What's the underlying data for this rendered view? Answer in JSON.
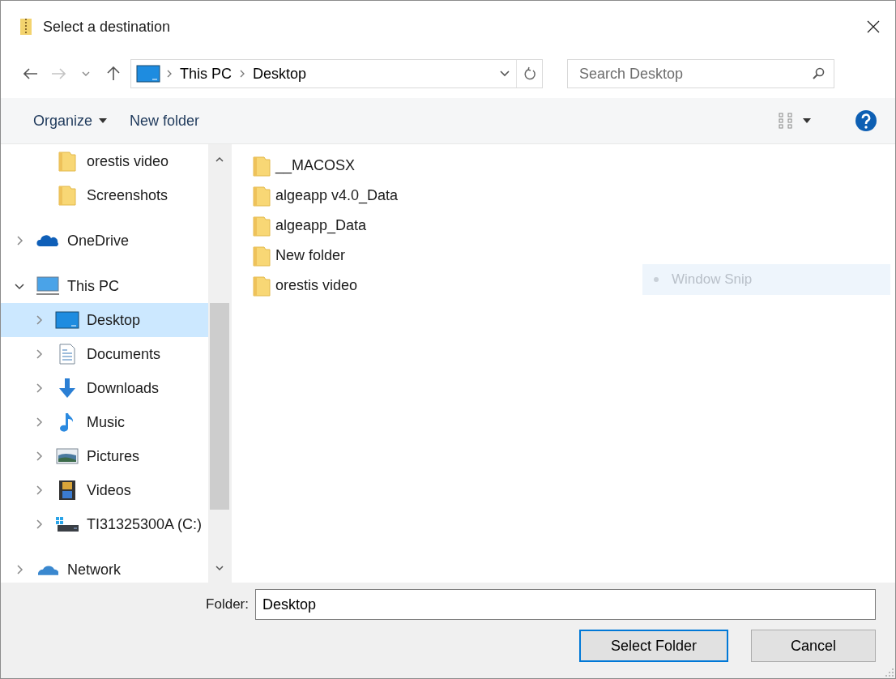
{
  "window": {
    "title": "Select a destination"
  },
  "address": {
    "crumbs": [
      "This PC",
      "Desktop"
    ]
  },
  "search": {
    "placeholder": "Search Desktop"
  },
  "toolbar": {
    "organize": "Organize",
    "new_folder": "New folder"
  },
  "sidebar": {
    "quick_access_children": [
      {
        "label": "orestis video",
        "kind": "folder"
      },
      {
        "label": "Screenshots",
        "kind": "folder"
      }
    ],
    "items": [
      {
        "label": "OneDrive",
        "kind": "onedrive",
        "expanded": false,
        "selected": false
      },
      {
        "label": "This PC",
        "kind": "pc",
        "expanded": true,
        "selected": false,
        "children": [
          {
            "label": "Desktop",
            "kind": "desktop",
            "expanded": false,
            "selected": true
          },
          {
            "label": "Documents",
            "kind": "documents",
            "expanded": false,
            "selected": false
          },
          {
            "label": "Downloads",
            "kind": "downloads",
            "expanded": false,
            "selected": false
          },
          {
            "label": "Music",
            "kind": "music",
            "expanded": false,
            "selected": false
          },
          {
            "label": "Pictures",
            "kind": "pictures",
            "expanded": false,
            "selected": false
          },
          {
            "label": "Videos",
            "kind": "videos",
            "expanded": false,
            "selected": false
          },
          {
            "label": "TI31325300A (C:)",
            "kind": "drive",
            "expanded": false,
            "selected": false
          }
        ]
      },
      {
        "label": "Network",
        "kind": "network",
        "expanded": false,
        "selected": false
      }
    ]
  },
  "files": [
    {
      "name": "__MACOSX"
    },
    {
      "name": "algeapp v4.0_Data"
    },
    {
      "name": "algeapp_Data"
    },
    {
      "name": "New folder"
    },
    {
      "name": "orestis video"
    }
  ],
  "snip_tooltip": {
    "label": "Window Snip"
  },
  "footer": {
    "folder_label": "Folder:",
    "folder_value": "Desktop",
    "buttons": [
      {
        "label": "Select Folder",
        "default": true
      },
      {
        "label": "Cancel",
        "default": false
      }
    ]
  }
}
